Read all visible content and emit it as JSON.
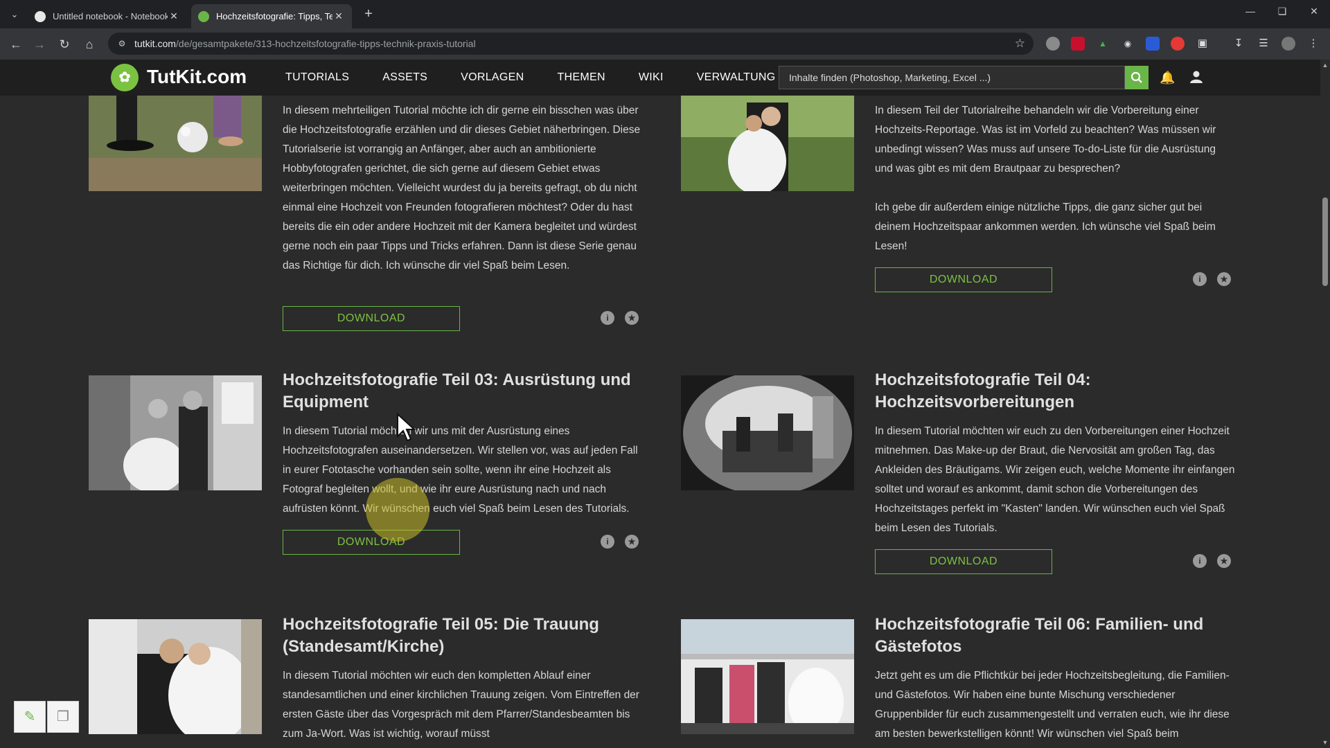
{
  "browser": {
    "tabs": [
      {
        "title": "Untitled notebook - Notebook",
        "close": "✕"
      },
      {
        "title": "Hochzeitsfotografie: Tipps, Tech",
        "close": "✕"
      }
    ],
    "new_tab": "+",
    "url_host": "tutkit.com",
    "url_path": "/de/gesamtpakete/313-hochzeitsfotografie-tipps-technik-praxis-tutorial"
  },
  "site": {
    "logo": "TutKit.com",
    "nav": [
      "TUTORIALS",
      "ASSETS",
      "VORLAGEN",
      "THEMEN",
      "WIKI",
      "VERWALTUNG"
    ],
    "search_placeholder": "Inhalte finden (Photoshop, Marketing, Excel ...)"
  },
  "cards": [
    {
      "title": "",
      "desc": "In diesem mehrteiligen Tutorial möchte ich dir gerne ein bisschen was über die Hochzeitsfotografie erzählen und dir dieses Gebiet näherbringen. Diese Tutorialserie ist vorrangig an Anfänger, aber auch an ambitionierte Hobbyfotografen gerichtet, die sich gerne auf diesem Gebiet etwas weiterbringen möchten. Vielleicht wurdest du ja bereits gefragt, ob du nicht einmal eine Hochzeit von Freunden fotografieren möchtest? Oder du hast bereits die ein oder andere Hochzeit mit der Kamera begleitet und würdest gerne noch ein paar Tipps und Tricks erfahren. Dann ist diese Serie genau das Richtige für dich. Ich wünsche dir viel Spaß beim Lesen.",
      "download": "DOWNLOAD"
    },
    {
      "title": "",
      "desc": "In diesem Teil der Tutorialreihe behandeln wir die Vorbereitung einer Hochzeits-Reportage. Was ist im Vorfeld zu beachten? Was müssen wir unbedingt wissen? Was muss auf unsere To-do-Liste für die Ausrüstung und was gibt es mit dem Brautpaar zu besprechen?",
      "desc2": "Ich gebe dir außerdem einige nützliche Tipps, die ganz sicher gut bei deinem Hochzeitspaar ankommen werden. Ich wünsche viel Spaß beim Lesen!",
      "download": "DOWNLOAD"
    },
    {
      "title": "Hochzeitsfotografie Teil 03: Ausrüstung und Equipment",
      "desc": "In diesem Tutorial möchten wir uns mit der Ausrüstung eines Hochzeitsfotografen auseinandersetzen. Wir stellen vor, was auf jeden Fall in eurer Fototasche vorhanden sein sollte, wenn ihr eine Hochzeit als Fotograf begleiten wollt, und wie ihr eure Ausrüstung nach und nach aufrüsten könnt. Wir wünschen euch viel Spaß beim Lesen des Tutorials.",
      "download": "DOWNLOAD"
    },
    {
      "title": "Hochzeitsfotografie Teil 04: Hochzeitsvorbereitungen",
      "desc": "In diesem Tutorial möchten wir euch zu den Vorbereitungen einer Hochzeit mitnehmen. Das Make-up der Braut, die Nervosität am großen Tag, das Ankleiden des Bräutigams. Wir zeigen euch, welche Momente ihr einfangen solltet und worauf es ankommt, damit schon die Vorbereitungen des Hochzeitstages perfekt im \"Kasten\" landen. Wir wünschen euch viel Spaß beim Lesen des Tutorials.",
      "download": "DOWNLOAD"
    },
    {
      "title": "Hochzeitsfotografie Teil 05: Die Trauung (Standesamt/Kirche)",
      "desc": "In diesem Tutorial möchten wir euch den kompletten Ablauf einer standesamtlichen und einer kirchlichen Trauung zeigen. Vom Eintreffen der ersten Gäste über das Vorgespräch mit dem Pfarrer/Standesbeamten bis zum Ja-Wort. Was ist wichtig, worauf müsst"
    },
    {
      "title": "Hochzeitsfotografie Teil 06: Familien- und Gästefotos",
      "desc": "Jetzt geht es um die Pflichtkür bei jeder Hochzeitsbegleitung, die Familien- und Gästefotos. Wir haben eine bunte Mischung verschiedener Gruppenbilder für euch zusammengestellt und verraten euch, wie ihr diese am besten bewerkstelligen könnt! Wir wünschen viel Spaß beim"
    }
  ],
  "colors": {
    "accent": "#6ab547",
    "background": "#2b2b2b",
    "header": "#1f1f1f"
  }
}
